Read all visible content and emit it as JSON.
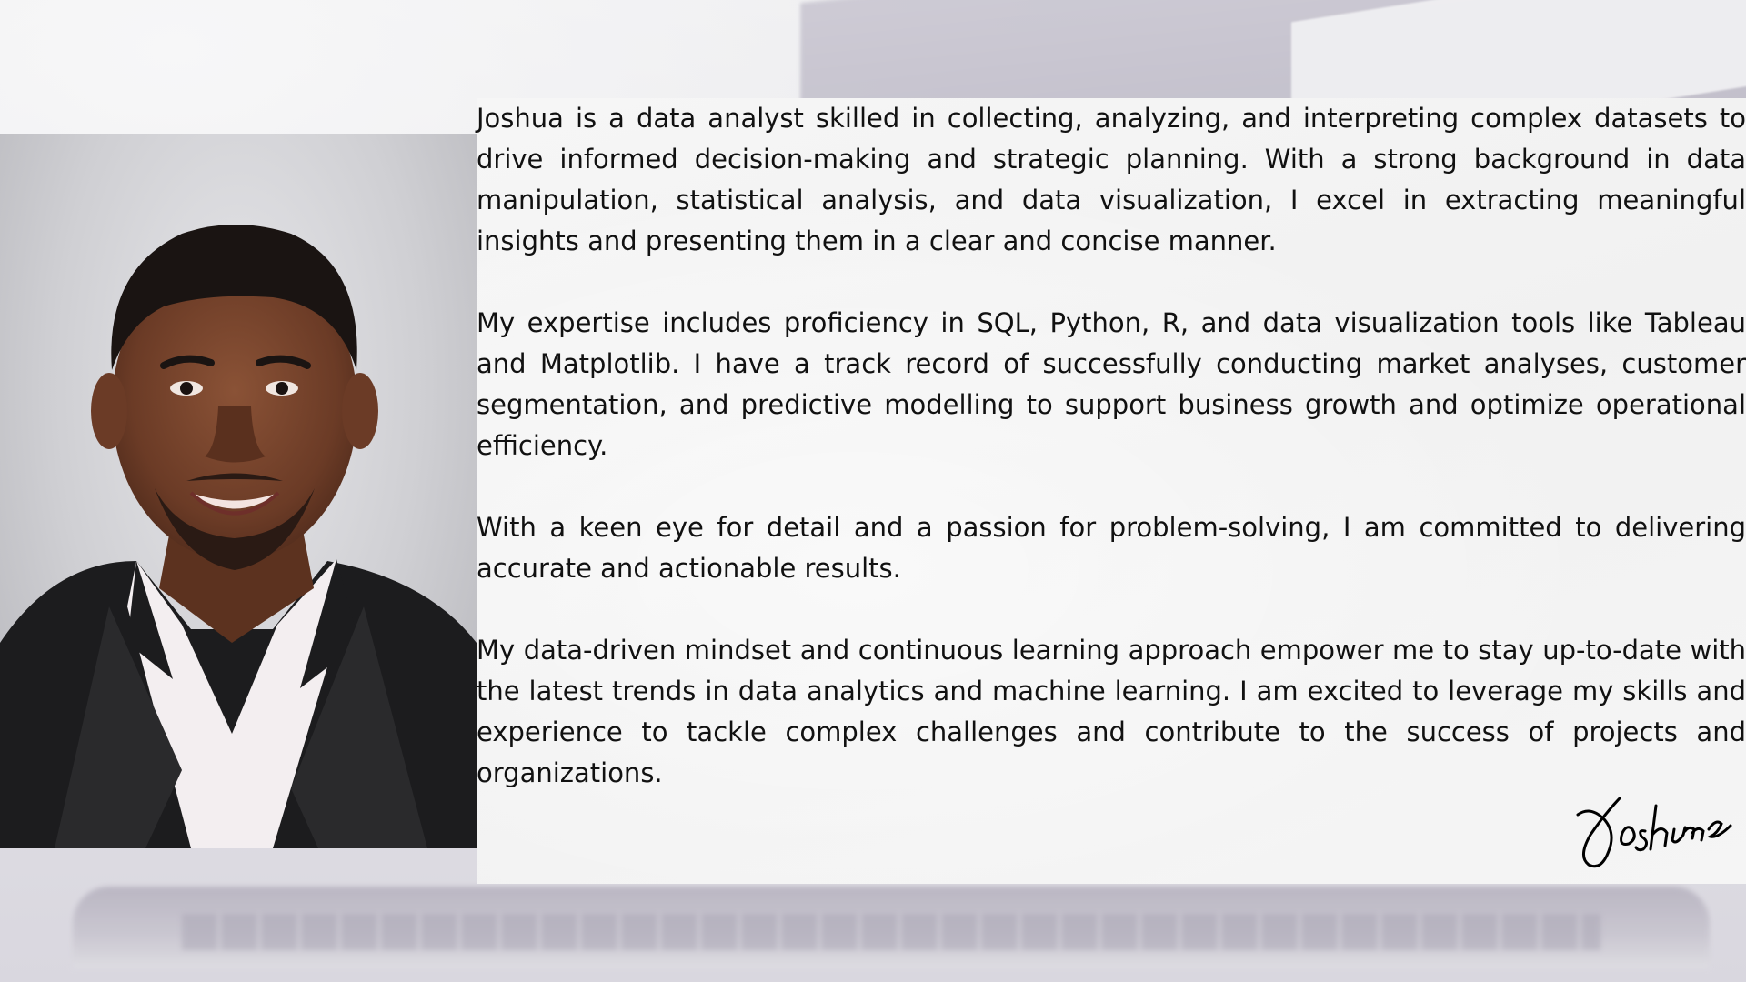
{
  "bio": {
    "paragraphs": [
      "Joshua is a data analyst skilled in collecting, analyzing, and interpreting complex datasets to drive informed decision-making and strategic planning. With a strong background in data manipulation, statistical analysis, and data visualization, I excel in extracting meaningful insights and presenting them in a clear and concise manner.",
      "My expertise includes proficiency in SQL, Python, R, and data visualization tools like Tableau and Matplotlib. I have a track record of successfully conducting market analyses, customer segmentation, and predictive modelling to support business growth and optimize operational efficiency.",
      "With a keen eye for detail and a passion for problem-solving, I am committed to delivering accurate and actionable results.",
      "My data-driven mindset and continuous learning approach empower me to stay up-to-date with the latest trends in data analytics and machine learning. I am excited to leverage my skills and experience to tackle complex challenges and contribute to the success of projects and organizations."
    ]
  },
  "signature": {
    "text": "Joshua"
  },
  "colors": {
    "text": "#111111",
    "panel": "#f4f4f4",
    "suit": "#1c1c1e",
    "shirt": "#f3eef0"
  },
  "icons": {
    "portrait": "person-photo",
    "signature": "handwritten-signature"
  }
}
